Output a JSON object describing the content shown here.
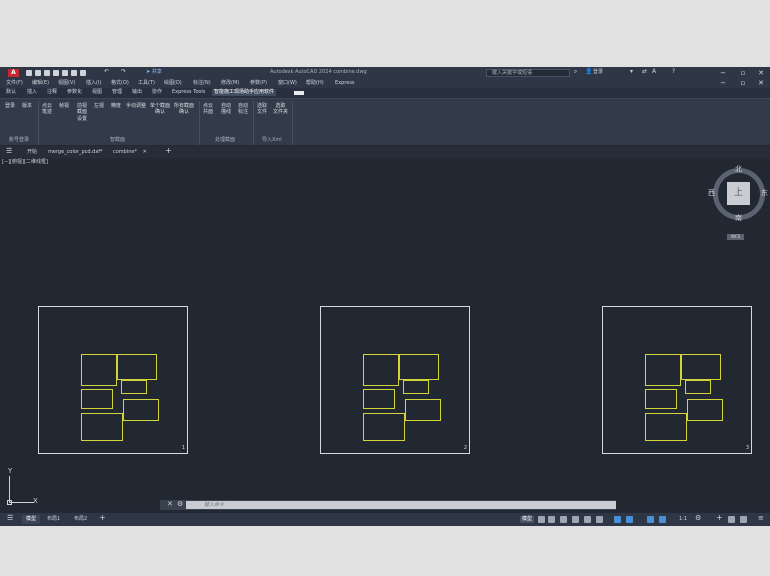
{
  "title_bar": {
    "logo": "A",
    "share_label": "共享",
    "title": "Autodesk AutoCAD 2024    combine.dwg",
    "search_placeholder": "键入关键字或短语",
    "user": "登录",
    "help": "?"
  },
  "menu_bar": [
    "文件(F)",
    "编辑(E)",
    "视图(V)",
    "插入(I)",
    "格式(O)",
    "工具(T)",
    "绘图(D)",
    "标注(N)",
    "修改(M)",
    "参数(P)",
    "窗口(W)",
    "帮助(H)",
    "Express"
  ],
  "ribbon_tabs": [
    {
      "label": "默认",
      "active": false
    },
    {
      "label": "插入",
      "active": false
    },
    {
      "label": "注释",
      "active": false
    },
    {
      "label": "参数化",
      "active": false
    },
    {
      "label": "视图",
      "active": false
    },
    {
      "label": "管理",
      "active": false
    },
    {
      "label": "输出",
      "active": false
    },
    {
      "label": "协作",
      "active": false
    },
    {
      "label": "Express Tools",
      "active": false
    },
    {
      "label": "智能施工现场助手应用软件",
      "active": true
    }
  ],
  "ribbon": {
    "buttons": [
      "登录",
      "版本",
      "点云\n笔迹",
      "帧视",
      "前视\n截面\n设置",
      "左视",
      "精度",
      "手动调整",
      "单个截面\n确认",
      "所有截面\n确认",
      "点云\n共面",
      "自动\n描线",
      "自动\n标注",
      "选取\n文件",
      "选取\n文件夹"
    ],
    "panels": [
      "账号登录",
      "智截面",
      "处理截面",
      "导入Xml"
    ]
  },
  "doc_tabs": [
    {
      "label": "开始",
      "active": false
    },
    {
      "label": "merge_color_pcd.dxf*",
      "active": false
    },
    {
      "label": "combine*",
      "active": true
    }
  ],
  "viewport_label": "[−][俯视][二维线框]",
  "viewcube": {
    "top": "上",
    "north": "北",
    "south": "南",
    "east": "东",
    "west": "西",
    "wcs": "WCS"
  },
  "sheets": [
    {
      "number": "1"
    },
    {
      "number": "2"
    },
    {
      "number": "3"
    }
  ],
  "ucs": {
    "x": "X",
    "y": "Y"
  },
  "command": {
    "placeholder": "键入命令"
  },
  "layout_tabs": [
    {
      "label": "模型",
      "active": true
    },
    {
      "label": "布局1",
      "active": false
    },
    {
      "label": "布局2",
      "active": false
    }
  ],
  "status": {
    "scale": "1:1"
  },
  "colors": {
    "accent": "#c5282e",
    "wall": "#d2d43a",
    "canvas": "#212831"
  }
}
